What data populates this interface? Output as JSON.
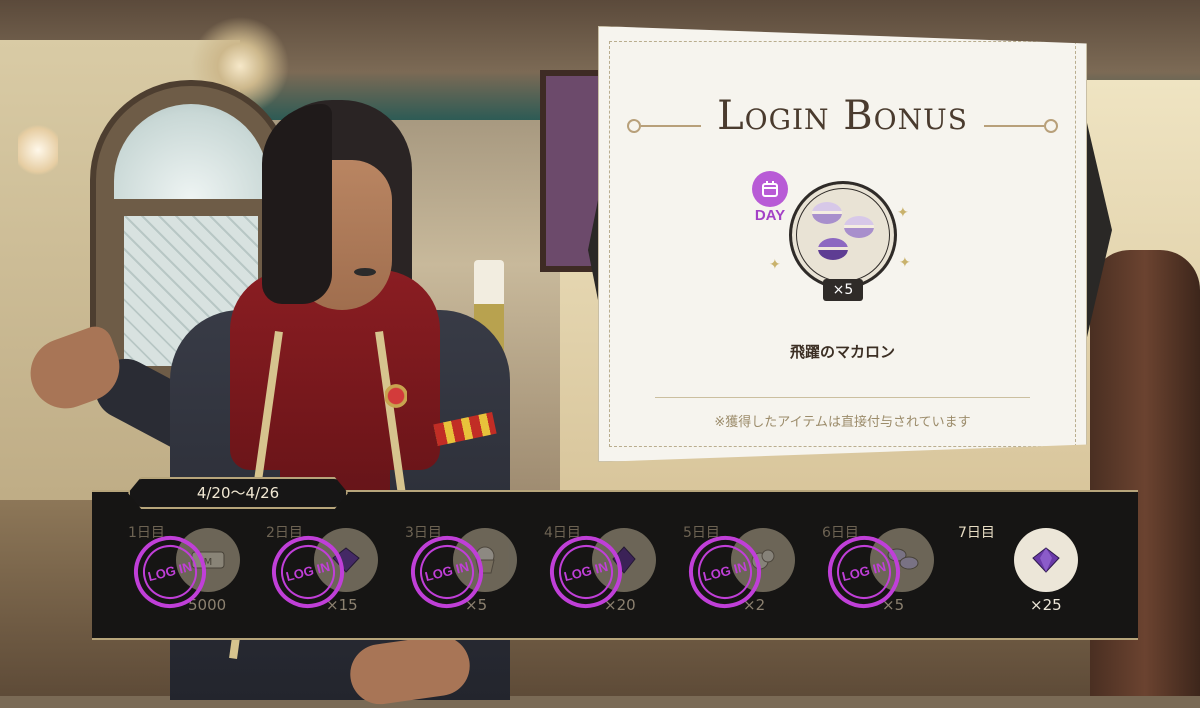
{
  "card": {
    "title": "Login Bonus",
    "day_badge_label": "DAY",
    "item_quantity": "×5",
    "item_name": "飛躍のマカロン",
    "note": "※獲得したアイテムは直接付与されています",
    "item_icon": "macaron-icon",
    "badge_icon": "calendar-icon"
  },
  "week": {
    "date_range": "4/20〜4/26",
    "days": [
      {
        "label": "1日目",
        "quantity": "5000",
        "icon": "madol-coin-icon",
        "claimed": true
      },
      {
        "label": "2日目",
        "quantity": "×15",
        "icon": "gem-icon",
        "claimed": true
      },
      {
        "label": "3日目",
        "quantity": "×5",
        "icon": "cupcake-icon",
        "claimed": true
      },
      {
        "label": "4日目",
        "quantity": "×20",
        "icon": "magic-crystal-icon",
        "claimed": true
      },
      {
        "label": "5日目",
        "quantity": "×2",
        "icon": "sparkle-item-icon",
        "claimed": true
      },
      {
        "label": "6日目",
        "quantity": "×5",
        "icon": "macaron-icon",
        "claimed": true
      },
      {
        "label": "7日目",
        "quantity": "×25",
        "icon": "gem-icon",
        "claimed": false
      }
    ]
  },
  "stamp_text": "LOG IN",
  "colors": {
    "stamp": "#c03fd8",
    "strip_bg": "#161514",
    "gold_border": "#b7a57b",
    "card_bg": "#f6f4ee",
    "day_badge": "#b85bd6"
  }
}
